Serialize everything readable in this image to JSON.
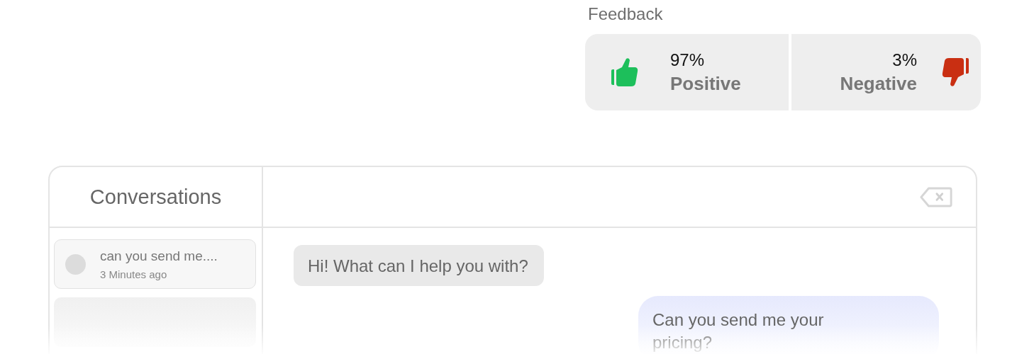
{
  "feedback": {
    "title": "Feedback",
    "items": [
      {
        "kind": "positive",
        "percent": "97%",
        "label": "Positive",
        "color": "#1dbf5b"
      },
      {
        "kind": "negative",
        "percent": "3%",
        "label": "Negative",
        "color": "#c92f12"
      }
    ]
  },
  "conversations": {
    "title": "Conversations",
    "items": [
      {
        "preview": "can you send me....",
        "time": "3 Minutes ago"
      }
    ]
  },
  "chat": {
    "messages": [
      {
        "kind": "bot",
        "text": "Hi! What can I help you with?"
      },
      {
        "kind": "user",
        "text": "Can you send me your pricing?"
      }
    ]
  }
}
